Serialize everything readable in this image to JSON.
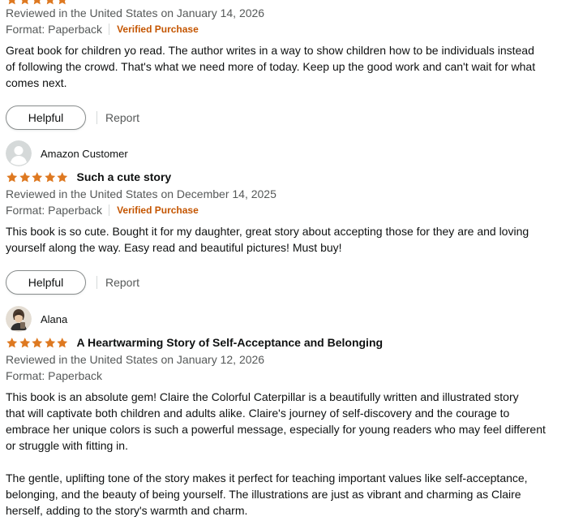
{
  "reviews": [
    {
      "reviewer": "",
      "title": "",
      "date": "Reviewed in the United States on January 14, 2026",
      "format": "Format: Paperback",
      "verified": "Verified Purchase",
      "rating": 5,
      "body": [
        "Great book for children yo read. The author writes in a way to show children how to be individuals instead",
        "of following the crowd. That's what we need more of today. Keep up the good work and can't wait for what",
        "comes next."
      ],
      "helpful_label": "Helpful",
      "report_label": "Report"
    },
    {
      "reviewer": "Amazon Customer",
      "title": "Such a cute story",
      "date": "Reviewed in the United States on December 14, 2025",
      "format": "Format: Paperback",
      "verified": "Verified Purchase",
      "rating": 5,
      "body": [
        "This book is so cute. Bought it for my daughter, great story about accepting those for they are and loving",
        "yourself along the way. Easy read and beautiful pictures! Must buy!"
      ],
      "helpful_label": "Helpful",
      "report_label": "Report"
    },
    {
      "reviewer": "Alana",
      "title": "A Heartwarming Story of Self-Acceptance and Belonging",
      "date": "Reviewed in the United States on January 12, 2026",
      "format": "Format: Paperback",
      "rating": 5,
      "body": [
        "This book is an absolute gem! Claire the Colorful Caterpillar is a beautifully written and illustrated story",
        "that will captivate both children and adults alike. Claire's journey of self-discovery and the courage to",
        "embrace her unique colors is such a powerful message, especially for young readers who may feel different",
        "or struggle with fitting in."
      ],
      "body2": [
        "The gentle, uplifting tone of the story makes it perfect for teaching important values like self-acceptance,",
        "belonging, and the beauty of being yourself. The illustrations are just as vibrant and charming as Claire",
        "herself, adding to the story's warmth and charm."
      ]
    }
  ],
  "colors": {
    "star": "#de7921",
    "verified": "#c45500",
    "meta": "#565959"
  },
  "icons": {
    "star": "star-icon",
    "avatar_default": "default-avatar-icon"
  }
}
